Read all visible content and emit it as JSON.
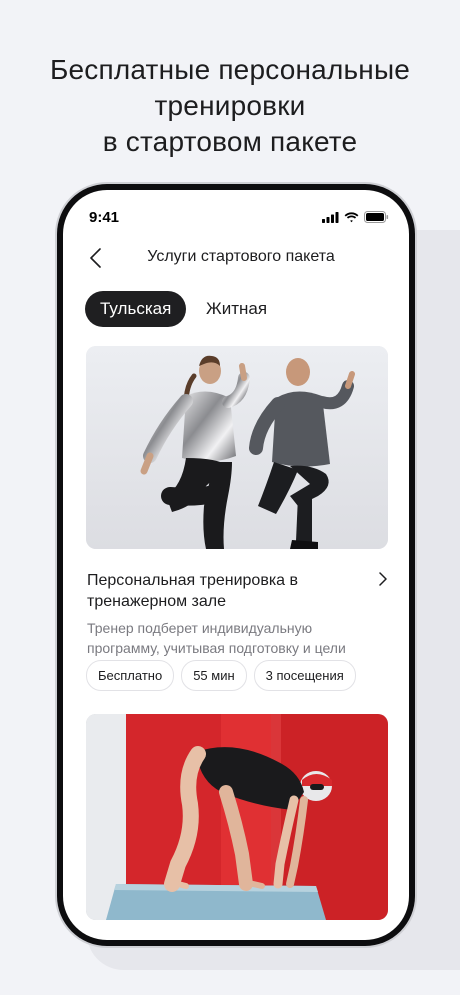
{
  "promo": {
    "line1": "Бесплатные персональные",
    "line2": "тренировки",
    "line3": "в стартовом пакете"
  },
  "status_bar": {
    "time": "9:41",
    "icons": [
      "signal-icon",
      "wifi-icon",
      "battery-icon"
    ]
  },
  "nav": {
    "back_icon": "chevron-left-icon",
    "title": "Услуги стартового пакета"
  },
  "segments": [
    {
      "label": "Тульская",
      "selected": true
    },
    {
      "label": "Житная",
      "selected": false
    }
  ],
  "cards": [
    {
      "title": "Персональная тренировка в тренажерном зале",
      "description": "Тренер подберет индивидуальную программу, учитывая подготовку и цели",
      "tags": [
        "Бесплатно",
        "55 мин",
        "3 посещения"
      ],
      "image": "gym-training-photo"
    },
    {
      "image": "swimmer-photo"
    }
  ],
  "colors": {
    "background": "#f2f3f7",
    "segment_active": "#1f1f21",
    "text_primary": "#1d1d1f",
    "text_secondary": "#7a7a80",
    "pool_red": "#d6262a"
  }
}
